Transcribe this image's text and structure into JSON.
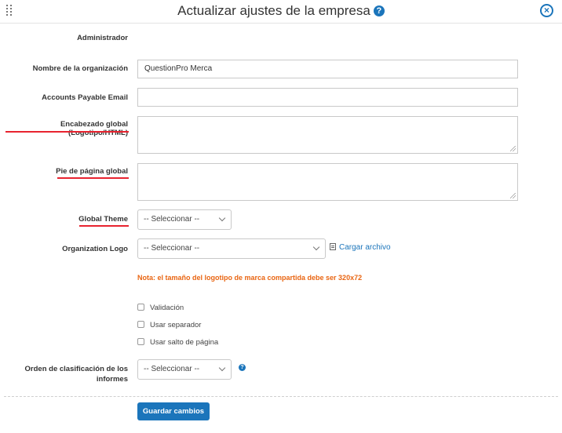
{
  "header": {
    "title": "Actualizar ajustes de la empresa",
    "help_glyph": "?",
    "close_glyph": "×"
  },
  "form": {
    "administrator_label": "Administrador",
    "organization_name": {
      "label": "Nombre de la organización",
      "value": "QuestionPro Merca"
    },
    "accounts_payable_email": {
      "label": "Accounts Payable Email",
      "value": ""
    },
    "global_header": {
      "label": "Encabezado global (Logotipo/HTML)",
      "value": ""
    },
    "global_footer": {
      "label": "Pie de página global",
      "value": ""
    },
    "global_theme": {
      "label": "Global Theme",
      "selected": "-- Seleccionar --"
    },
    "organization_logo": {
      "label": "Organization Logo",
      "selected": "-- Seleccionar --",
      "upload_label": "Cargar archivo"
    },
    "logo_note": "Nota: el tamaño del logotipo de marca compartida debe ser 320x72",
    "checkboxes": [
      {
        "label": "Validación",
        "checked": false
      },
      {
        "label": "Usar separador",
        "checked": false
      },
      {
        "label": "Usar salto de página",
        "checked": false
      }
    ],
    "report_sort_order": {
      "label_line1": "Orden de clasificación de los",
      "label_line2": "informes",
      "selected": "-- Seleccionar --"
    },
    "save_label": "Guardar cambios"
  },
  "colors": {
    "accent": "#1b75bb",
    "note": "#e96512",
    "highlight_underline": "#e8232f"
  },
  "icons": [
    "drag-handle-icon",
    "help-icon",
    "close-icon",
    "file-icon",
    "chevron-down-icon"
  ]
}
